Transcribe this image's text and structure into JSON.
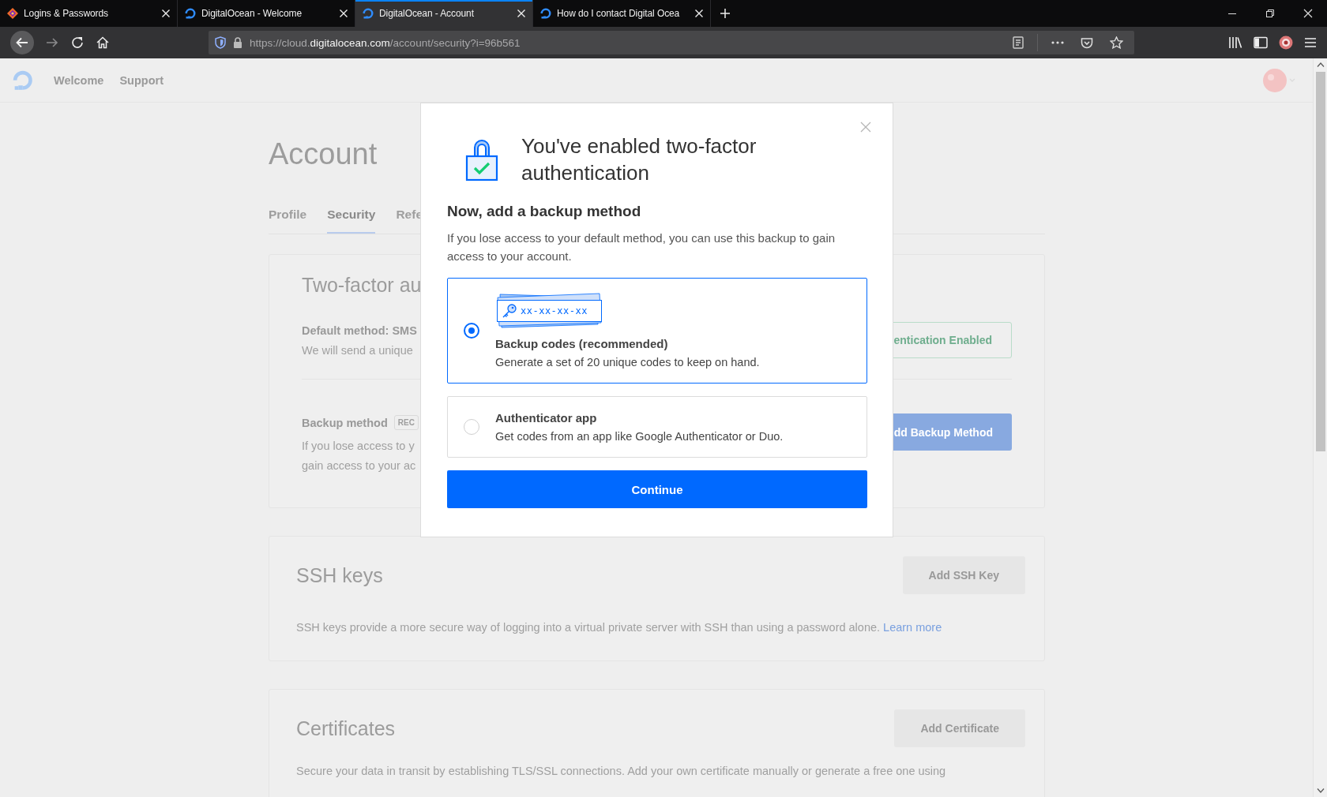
{
  "browser": {
    "tabs": [
      {
        "title": "Logins & Passwords",
        "kind": "passwords",
        "selected": false
      },
      {
        "title": "DigitalOcean - Welcome",
        "kind": "site",
        "selected": false
      },
      {
        "title": "DigitalOcean - Account",
        "kind": "site",
        "selected": true
      },
      {
        "title": "How do I contact Digital Ocea",
        "kind": "site",
        "selected": false
      }
    ],
    "url": {
      "prefix": "https://cloud.",
      "domain": "digitalocean.com",
      "path": "/account/security?i=96b561"
    }
  },
  "header": {
    "nav": [
      {
        "label": "Welcome"
      },
      {
        "label": "Support"
      }
    ]
  },
  "page": {
    "title": "Account",
    "tabs": [
      {
        "label": "Profile",
        "selected": false
      },
      {
        "label": "Security",
        "selected": true
      },
      {
        "label": "Refe",
        "selected": false
      }
    ],
    "two_factor": {
      "title": "Two-factor au",
      "default_method": "Default method: SMS",
      "default_text": "We will send a unique",
      "status_button": "entication Enabled",
      "backup_label": "Backup method",
      "backup_badge": "REC",
      "backup_lines": [
        "If you lose access to y",
        "gain access to your ac"
      ],
      "backup_button": "dd Backup Method"
    },
    "sections": [
      {
        "title": "SSH keys",
        "button": "Add SSH Key",
        "text": "SSH keys provide a more secure way of logging into a virtual private server with SSH than using a password alone.",
        "link": "Learn more"
      },
      {
        "title": "Certificates",
        "button": "Add Certificate",
        "text": "Secure your data in transit by establishing TLS/SSL connections. Add your own certificate manually or generate a free one using"
      }
    ]
  },
  "modal": {
    "title": "You've enabled two-factor authentication",
    "subtitle": "Now, add a backup method",
    "description": "If you lose access to your default method, you can use this backup to gain access to your account.",
    "options": [
      {
        "kind": "codes",
        "sample": "xx-xx-xx-xx",
        "title": "Backup codes (recommended)",
        "description": "Generate a set of 20 unique codes to keep on hand.",
        "selected": true
      },
      {
        "kind": "app",
        "title": "Authenticator app",
        "description": "Get codes from an app like Google Authenticator or Duo.",
        "selected": false
      }
    ],
    "button": "Continue"
  }
}
